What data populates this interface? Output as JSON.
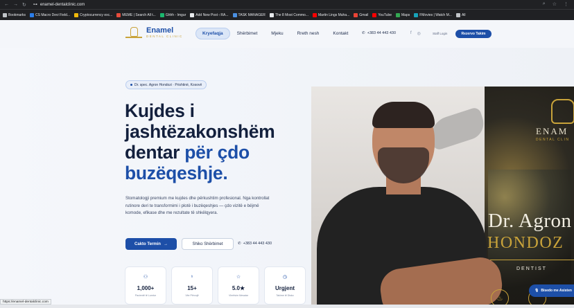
{
  "browser": {
    "url": "enamel-dentalclinic.com",
    "bookmarks": [
      {
        "label": "Bookmarks",
        "color": "#c0c4c8"
      },
      {
        "label": "CS Macro Devi Field...",
        "color": "#2b7de9"
      },
      {
        "label": "Cryptocurrency exc...",
        "color": "#f0b90b"
      },
      {
        "label": "MEME | Search All t...",
        "color": "#e74c3c"
      },
      {
        "label": "Ghhh - Imgur",
        "color": "#1bb76e"
      },
      {
        "label": "Add New Post ‹ RA...",
        "color": "#e8eaed"
      },
      {
        "label": "TASK MANAGER",
        "color": "#4a90e2"
      },
      {
        "label": "The 8 Most Commo...",
        "color": "#e8eaed"
      },
      {
        "label": "Martin Lings Muha...",
        "color": "#ff0000"
      },
      {
        "label": "Gmail",
        "color": "#ea4335"
      },
      {
        "label": "YouTube",
        "color": "#ff0000"
      },
      {
        "label": "Maps",
        "color": "#34a853"
      },
      {
        "label": "FMovies | Watch M...",
        "color": "#17a2b8"
      },
      {
        "label": "All",
        "color": "#c0c4c8"
      }
    ],
    "status_url": "https://enamel-dentalclinic.com"
  },
  "header": {
    "logo_name": "Enamel",
    "logo_sub": "DENTAL CLINIC",
    "nav": [
      "Kryefaqja",
      "Shërbimet",
      "Mjeku",
      "Rreth nesh",
      "Kontakt"
    ],
    "phone": "+383 44 443 430",
    "staff_login": "Staff Login",
    "reserve": "Rezervo Takim"
  },
  "hero": {
    "badge": "Dr. spec. Agron Hondozi · Prishtinë, Kosovë",
    "headline_1": "Kujdes i",
    "headline_2": "jashtëzakonshëm",
    "headline_3a": "dentar ",
    "headline_3b": "për çdo",
    "headline_4": "buzëqeshje.",
    "description": "Stomatologji premium me kujdes dhe përkushtim profesional. Nga kontrollat rutinore deri te transformimi i plotë i buzëqeshjes — çdo vizitë e bëjmë komode, efikase dhe me rezultate të shkëlqyera.",
    "cta_primary": "Cakto Termin",
    "cta_secondary": "Shiko Shërbimet",
    "phone": "+383 44 443 430"
  },
  "stats": [
    {
      "icon": "users-icon",
      "value": "1,000+",
      "label": "Pacientë të Lumtur"
    },
    {
      "icon": "award-icon",
      "value": "15+",
      "label": "Vite Përvojë"
    },
    {
      "icon": "star-icon",
      "value": "5.0★",
      "label": "Vlerësim Mesatar"
    },
    {
      "icon": "clock-icon",
      "value": "Urgjent",
      "label": "Takime të Disko"
    }
  ],
  "poster": {
    "brand": "ENAM",
    "brand_sub": "DENTAL CLIN",
    "title_1": "Dr. Agron",
    "title_2": "HONDOZ",
    "role": "DENTIST"
  },
  "assistant": "Bisedo me Asisten",
  "colors": {
    "primary": "#1d4fa8",
    "gold": "#c9a33a",
    "text": "#13203d"
  }
}
